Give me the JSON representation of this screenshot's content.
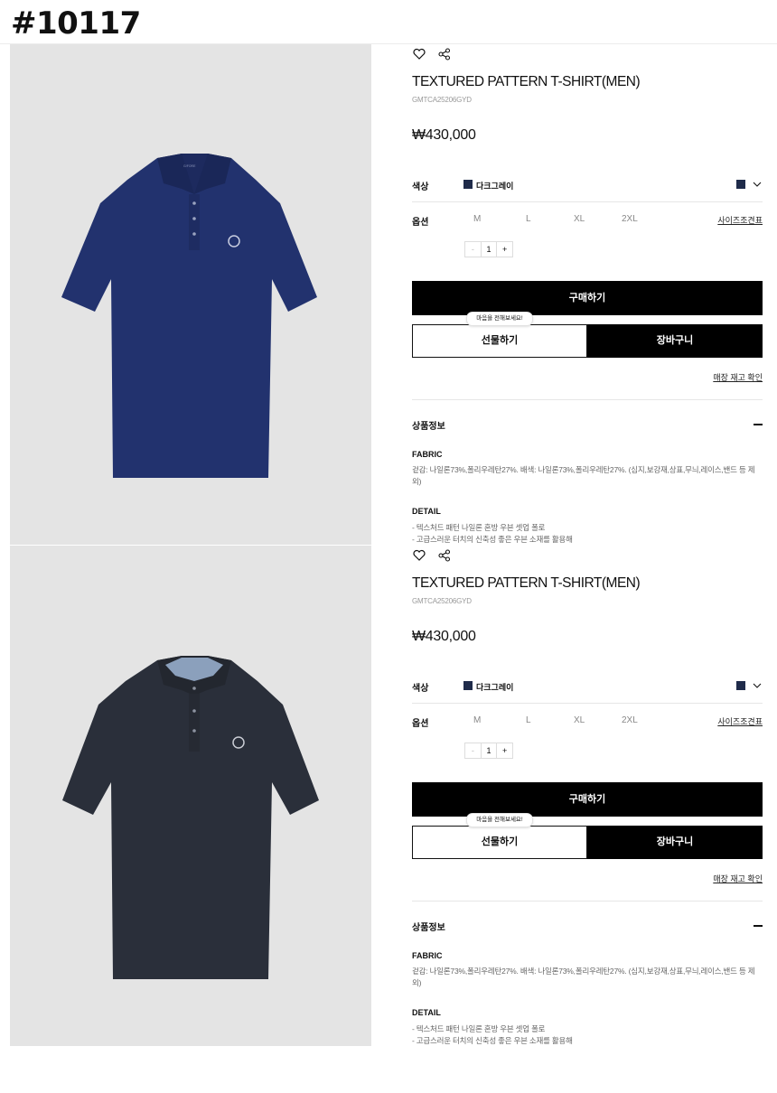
{
  "tag": "#10117",
  "product": {
    "title": "TEXTURED PATTERN T-SHIRT(MEN)",
    "code": "GMTCA25206GYD",
    "price": "₩430,000",
    "color_label": "색상",
    "color_name": "다크그레이",
    "color_swatch": "#1f2b4a",
    "option_label": "옵션",
    "sizes": [
      "M",
      "L",
      "XL",
      "2XL"
    ],
    "size_guide": "사이즈조견표",
    "quantity": {
      "minus": "-",
      "value": "1",
      "plus": "+"
    },
    "buy_label": "구매하기",
    "gift_label": "선물하기",
    "gift_bubble": "마음을 전해보세요!",
    "cart_label": "장바구니",
    "stock_label": "매장 재고 확인",
    "info_heading": "상품정보",
    "fabric_heading": "FABRIC",
    "fabric_text": "겉감: 나일론73%,폴리우레탄27%. 배색: 나일론73%,폴리우레탄27%. (심지,보강재,상표,무늬,레이스,밴드 등 제외)",
    "detail_heading": "DETAIL",
    "detail_lines": [
      "- 텍스처드 패턴 나일론 혼방 우븐 셋업 폴로",
      "- 고급스러운 터치의 신축성 좋은 우븐 소재를 활용해"
    ]
  },
  "variants": [
    {
      "shirt_color": "#22326e"
    },
    {
      "shirt_color": "#2a2f3a"
    }
  ]
}
